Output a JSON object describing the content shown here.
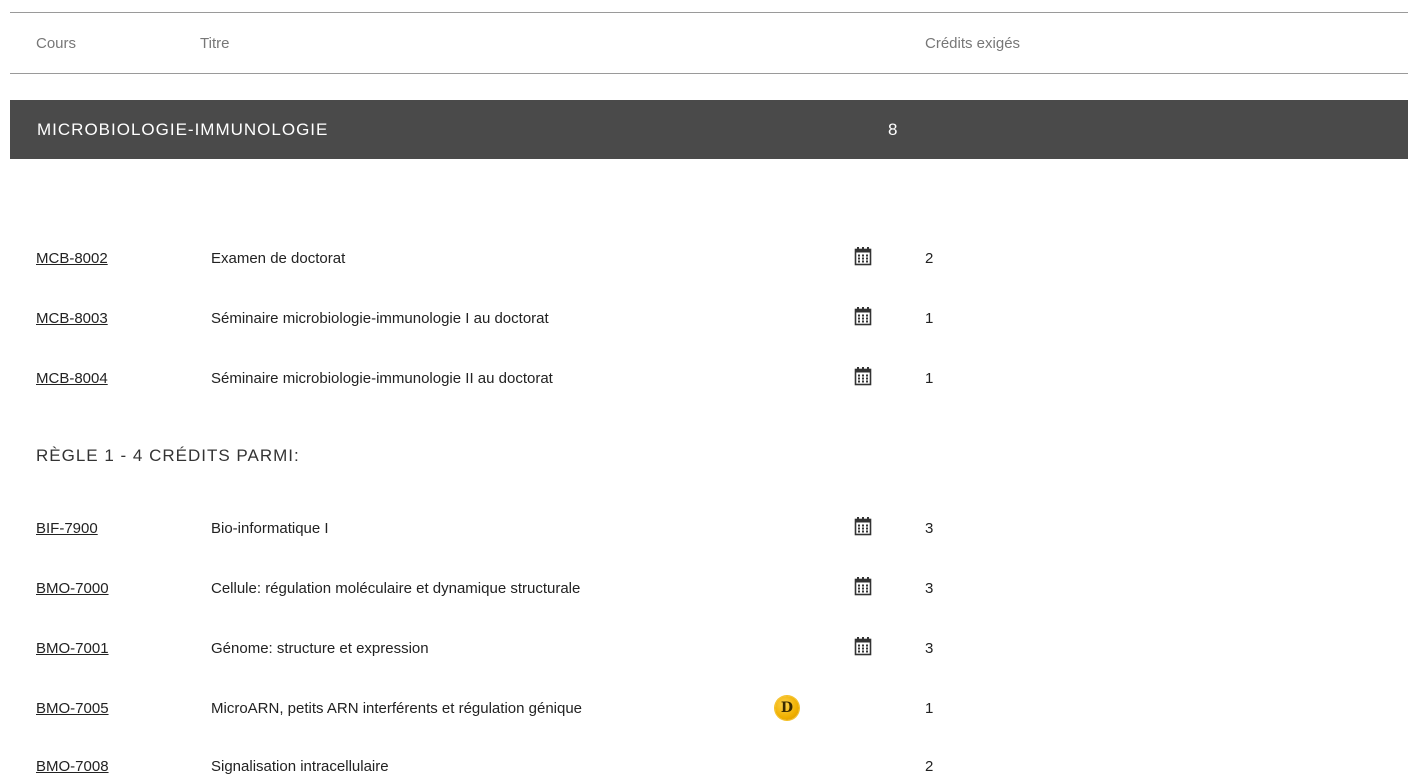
{
  "table_header": {
    "course_col": "Cours",
    "title_col": "Titre",
    "credits_col": "Crédits exigés"
  },
  "section": {
    "title": "MICROBIOLOGIE-IMMUNOLOGIE",
    "credits": "8"
  },
  "required_courses": [
    {
      "code": "MCB-8002",
      "title": "Examen de doctorat",
      "icon": "calendar-icon",
      "credits": "2"
    },
    {
      "code": "MCB-8003",
      "title": "Séminaire microbiologie-immunologie I au doctorat",
      "icon": "calendar-icon",
      "credits": "1"
    },
    {
      "code": "MCB-8004",
      "title": "Séminaire microbiologie-immunologie II au doctorat",
      "icon": "calendar-icon",
      "credits": "1"
    }
  ],
  "rule": {
    "heading": "RÈGLE 1 - 4 CRÉDITS PARMI:"
  },
  "rule_courses": [
    {
      "code": "BIF-7900",
      "title": "Bio-informatique I",
      "icon": "calendar-icon",
      "credits": "3"
    },
    {
      "code": "BMO-7000",
      "title": "Cellule: régulation moléculaire et dynamique structurale",
      "icon": "calendar-icon",
      "credits": "3"
    },
    {
      "code": "BMO-7001",
      "title": "Génome: structure et expression",
      "icon": "calendar-icon",
      "credits": "3"
    },
    {
      "code": "BMO-7005",
      "title": "MicroARN, petits ARN interférents et régulation génique",
      "icon": "d-badge-icon",
      "badge_letter": "D",
      "credits": "1"
    },
    {
      "code": "BMO-7008",
      "title": "Signalisation intracellulaire",
      "icon": "none",
      "credits": "2"
    }
  ],
  "colors": {
    "section_bar": "#4a4a4a",
    "badge": "#f0b000"
  }
}
